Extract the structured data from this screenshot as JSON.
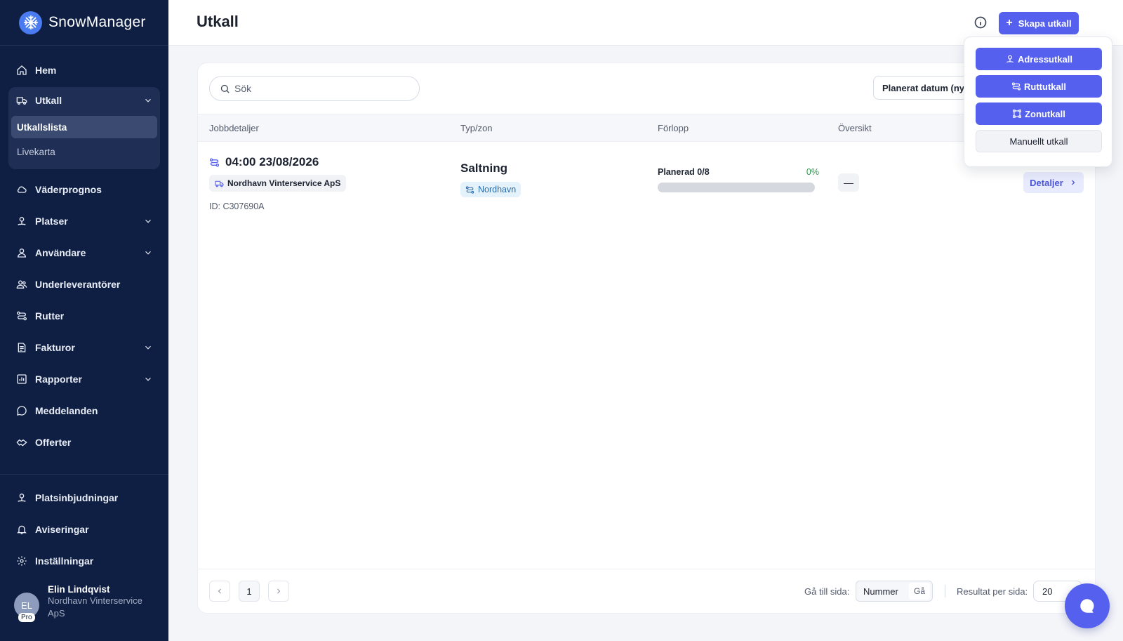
{
  "brand": {
    "name": "SnowManager"
  },
  "sidebar": {
    "items": [
      {
        "label": "Hem",
        "icon": "home-icon"
      },
      {
        "label": "Utkall",
        "icon": "truck-icon",
        "expanded": true,
        "children": [
          {
            "label": "Utkallslista",
            "active": true
          },
          {
            "label": "Livekarta"
          }
        ]
      },
      {
        "label": "Väderprognos",
        "icon": "cloud-icon"
      },
      {
        "label": "Platser",
        "icon": "location-icon"
      },
      {
        "label": "Användare",
        "icon": "user-icon"
      },
      {
        "label": "Underleverantörer",
        "icon": "users-icon"
      },
      {
        "label": "Rutter",
        "icon": "route-icon"
      },
      {
        "label": "Fakturor",
        "icon": "invoice-icon"
      },
      {
        "label": "Rapporter",
        "icon": "chart-icon"
      },
      {
        "label": "Meddelanden",
        "icon": "message-icon"
      },
      {
        "label": "Offerter",
        "icon": "handshake-icon"
      }
    ],
    "bottom": [
      {
        "label": "Platsinbjudningar",
        "icon": "location-invite-icon"
      },
      {
        "label": "Aviseringar",
        "icon": "bell-icon"
      },
      {
        "label": "Inställningar",
        "icon": "gear-icon"
      }
    ],
    "user": {
      "initials": "EL",
      "badge": "Pro",
      "name": "Elin Lindqvist",
      "org": "Nordhavn Vinterservice ApS"
    }
  },
  "header": {
    "title": "Utkall",
    "create_label": "Skapa utkall"
  },
  "dropdown": {
    "items": [
      {
        "label": "Adressutkall",
        "icon": "location-icon"
      },
      {
        "label": "Ruttutkall",
        "icon": "route-icon"
      },
      {
        "label": "Zonutkall",
        "icon": "zone-icon"
      },
      {
        "label": "Manuellt utkall"
      }
    ]
  },
  "search": {
    "placeholder": "Sök"
  },
  "sort": {
    "label": "Planerat datum (nyas"
  },
  "table": {
    "columns": [
      "Jobbdetaljer",
      "Typ/zon",
      "Förlopp",
      "Översikt"
    ],
    "rows": [
      {
        "time": "04:00 23/08/2026",
        "company": "Nordhavn Vinterservice ApS",
        "id": "ID: C307690A",
        "type": "Saltning",
        "zone": "Nordhavn",
        "progress_label": "Planerad 0/8",
        "progress_pct_text": "0%",
        "progress_fraction": 0,
        "overview": "—",
        "details_label": "Detaljer"
      }
    ]
  },
  "pagination": {
    "current_page": "1",
    "goto_label": "Gå till sida:",
    "goto_placeholder": "Nummer",
    "goto_button": "Gå",
    "per_page_label": "Resultat per sida:",
    "per_page_value": "20"
  },
  "colors": {
    "primary": "#5561ee",
    "sidebar": "#0f1f43",
    "success": "#29974b"
  }
}
